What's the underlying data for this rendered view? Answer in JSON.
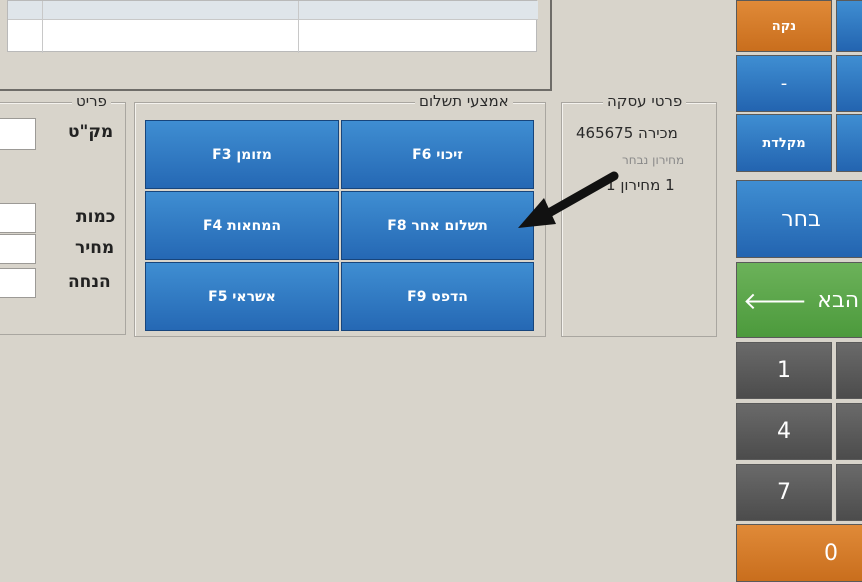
{
  "grid": {
    "rows": 2
  },
  "item_group": {
    "legend": "פריט",
    "catalog_label": "מק\"ט",
    "quantity_label": "כמות",
    "price_label": "מחיר",
    "discount_label": "הנחה"
  },
  "payment_group": {
    "legend": "אמצעי תשלום",
    "buttons": [
      {
        "label": "זיכוי F6"
      },
      {
        "label": "מזומן F3"
      },
      {
        "label": "תשלום אחר F8"
      },
      {
        "label": "המחאות F4"
      },
      {
        "label": "הדפס F9"
      },
      {
        "label": "אשראי F5"
      }
    ]
  },
  "transaction_group": {
    "legend": "פרטי עסקה",
    "sale_label": "מכירה 465675",
    "pricelist_hint": "מחירון נבחר",
    "pricelist_value": "1  מחירון 1"
  },
  "keypad": {
    "clear": "נקה",
    "minus": "-",
    "keyboard": "מקלדת",
    "select": "בחר",
    "next": "הבא",
    "next_arrow": "🡐",
    "k1": "1",
    "k4": "4",
    "k7": "7",
    "k0": "0"
  },
  "colors": {
    "accent_blue": "#2f7ac5",
    "orange": "#d57a28",
    "green": "#5aa548",
    "gray_key": "#5a5a5a",
    "background": "#d8d4cb"
  },
  "annotation": {
    "icon": "arrow-pointer-icon"
  }
}
